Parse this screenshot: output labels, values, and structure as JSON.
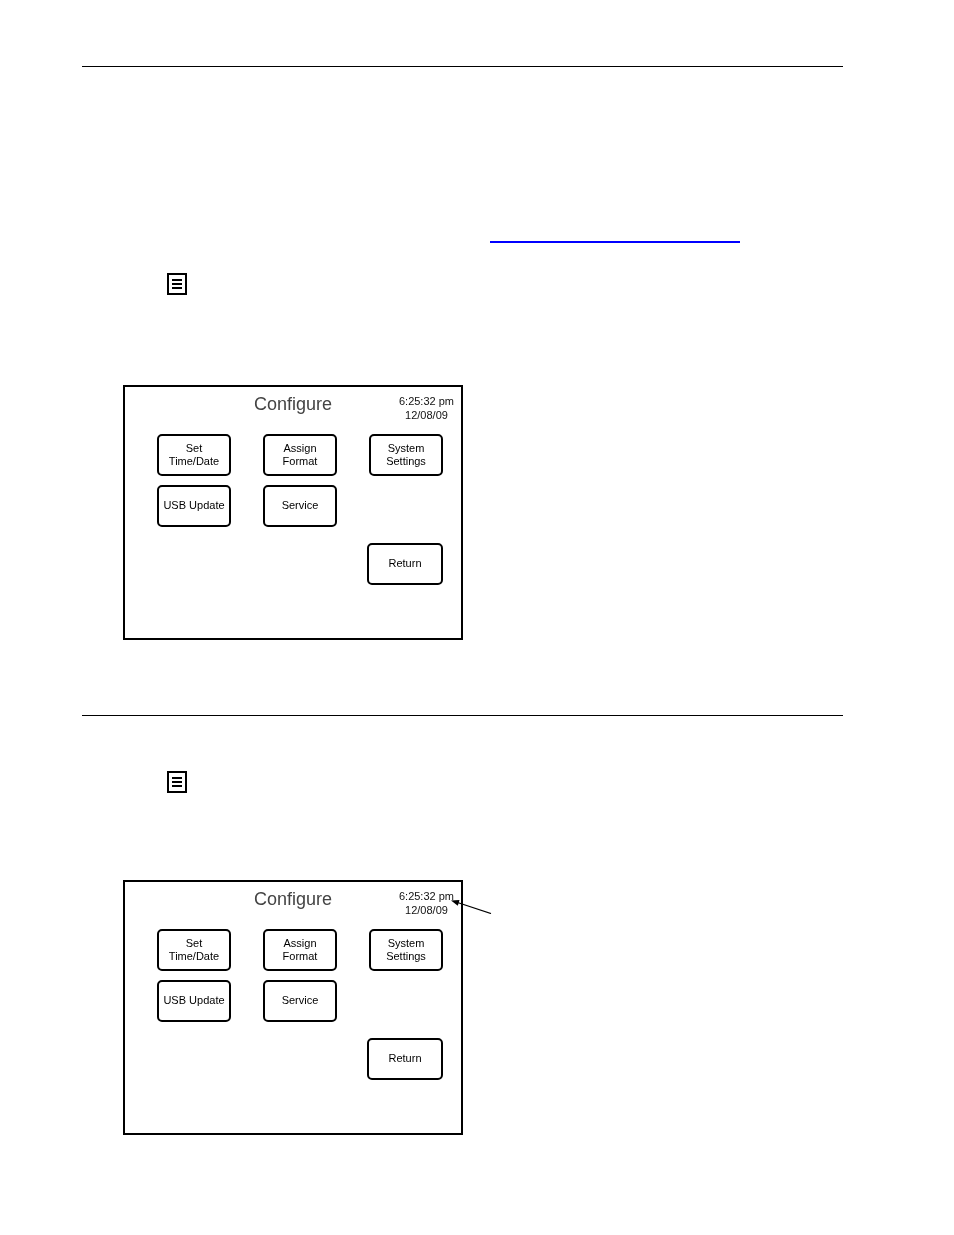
{
  "screens": [
    {
      "title": "Configure",
      "time": "6:25:32 pm",
      "date": "12/08/09",
      "pointer_arrow": false,
      "buttons": [
        {
          "label": "Set\nTime/Date"
        },
        {
          "label": "Assign\nFormat"
        },
        {
          "label": "System\nSettings"
        },
        {
          "label": "USB Update"
        },
        {
          "label": "Service"
        }
      ],
      "return_button": "Return"
    },
    {
      "title": "Configure",
      "time": "6:25:32 pm",
      "date": "12/08/09",
      "pointer_arrow": true,
      "buttons": [
        {
          "label": "Set\nTime/Date"
        },
        {
          "label": "Assign\nFormat"
        },
        {
          "label": "System\nSettings"
        },
        {
          "label": "USB Update"
        },
        {
          "label": "Service"
        }
      ],
      "return_button": "Return"
    }
  ]
}
